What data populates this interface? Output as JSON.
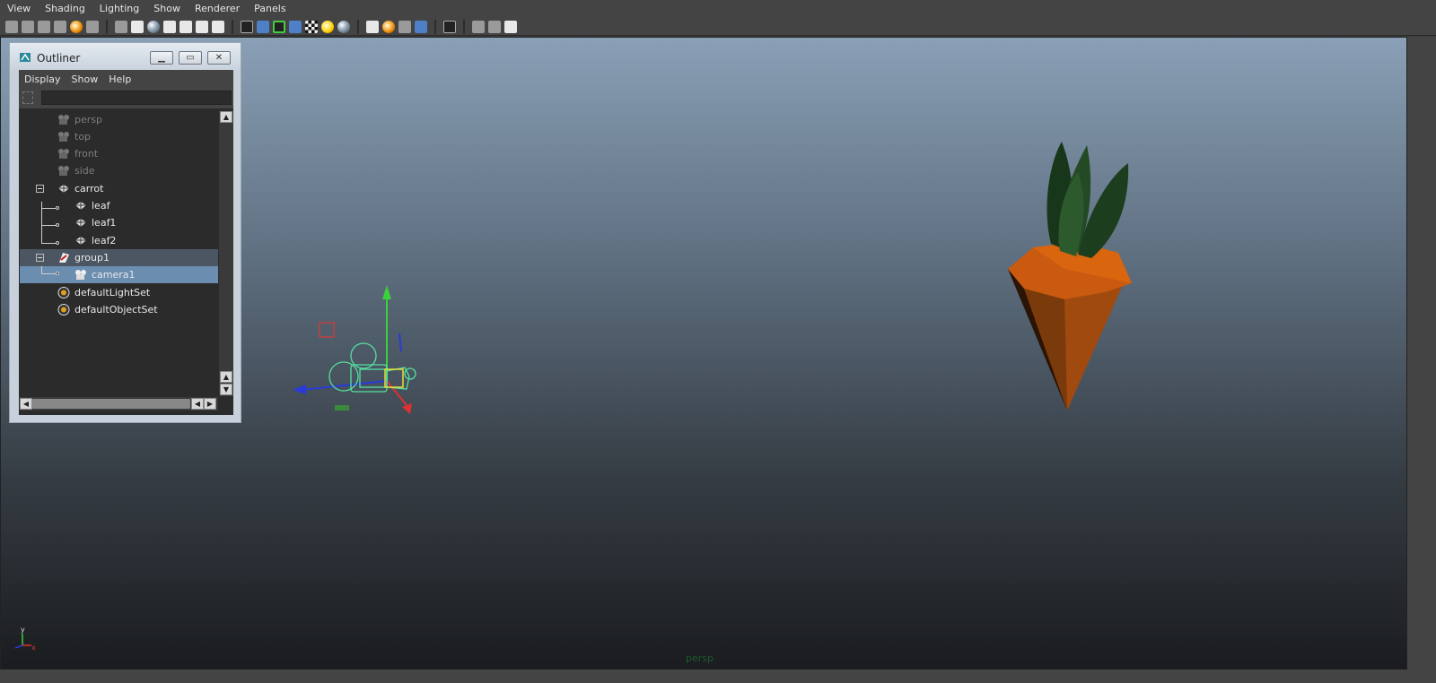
{
  "menubar": {
    "items": [
      "View",
      "Shading",
      "Lighting",
      "Show",
      "Renderer",
      "Panels"
    ]
  },
  "toolbar": {
    "icons": [
      "camera-icon",
      "camera-attributes-icon",
      "bookmark-icon",
      "grid-icon",
      "light-icon",
      "xray-icon",
      "isolate-icon",
      "wireframe-icon",
      "smooth-shade-icon",
      "default-material-icon",
      "texture-icon",
      "textured-icon",
      "use-lights-icon",
      "shadows-icon",
      "ambient-occlusion-icon",
      "motion-blur-icon",
      "antialias-icon",
      "depth-of-field-icon",
      "select-icon",
      "isolate-select-icon",
      "xray-joints-icon",
      "hud-icon"
    ]
  },
  "outliner": {
    "title": "Outliner",
    "menu": [
      "Display",
      "Show",
      "Help"
    ],
    "search_value": "",
    "items": [
      {
        "label": "persp",
        "icon": "camera-icon",
        "dim": true
      },
      {
        "label": "top",
        "icon": "camera-icon",
        "dim": true
      },
      {
        "label": "front",
        "icon": "camera-icon",
        "dim": true
      },
      {
        "label": "side",
        "icon": "camera-icon",
        "dim": true
      },
      {
        "label": "carrot",
        "icon": "mesh-icon",
        "dim": false
      },
      {
        "label": "leaf",
        "icon": "mesh-icon",
        "dim": false
      },
      {
        "label": "leaf1",
        "icon": "mesh-icon",
        "dim": false
      },
      {
        "label": "leaf2",
        "icon": "mesh-icon",
        "dim": false
      },
      {
        "label": "group1",
        "icon": "group-icon",
        "dim": false
      },
      {
        "label": "camera1",
        "icon": "camera-icon",
        "dim": false
      },
      {
        "label": "defaultLightSet",
        "icon": "set-icon",
        "dim": false
      },
      {
        "label": "defaultObjectSet",
        "icon": "set-icon",
        "dim": false
      }
    ],
    "selected": "camera1",
    "highlighted": "group1"
  },
  "viewport": {
    "camera_label": "persp",
    "axis": {
      "y": "y",
      "x": "x"
    },
    "colors": {
      "carrot": "#c95a10",
      "leaf": "#1f4a20",
      "camera_wire": "#55e0a0"
    }
  }
}
